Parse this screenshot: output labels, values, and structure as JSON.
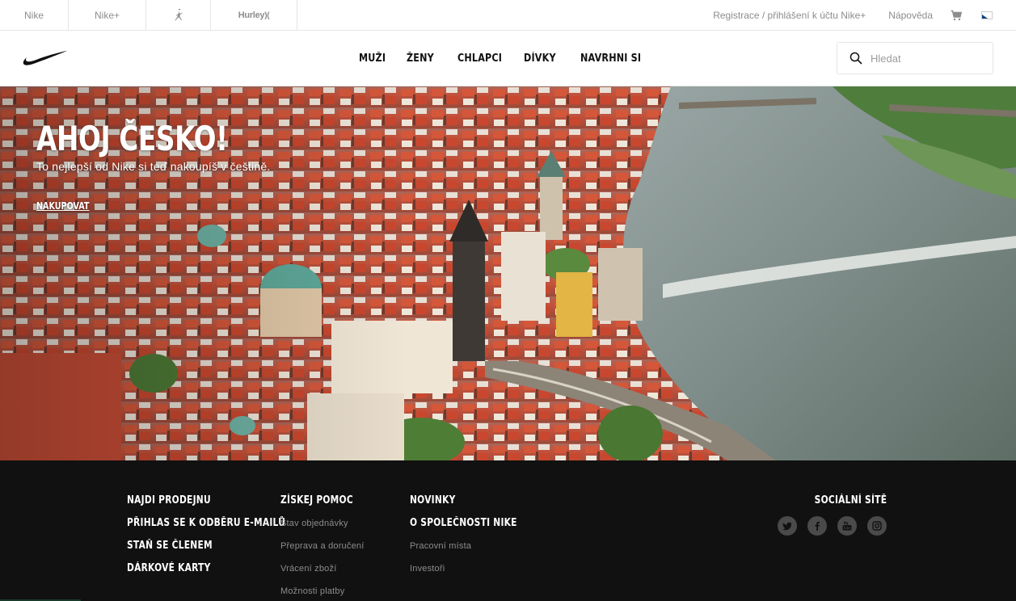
{
  "topbar": {
    "brand_tabs": [
      "Nike",
      "Nike+",
      "jordan-jumpman-logo",
      "Hurley"
    ],
    "nike_label": "Nike",
    "nikeplus_label": "Nike+",
    "hurley_label": "Hurley",
    "register_label": "Registrace / přihlášení k účtu Nike+",
    "help_label": "Nápověda",
    "cart_icon": "cart-icon",
    "flag_icon": "czech-flag-icon"
  },
  "nav": {
    "logo": "nike-swoosh-logo",
    "items": [
      {
        "label": "MUŽI"
      },
      {
        "label": "ŽENY"
      },
      {
        "label": "CHLAPCI"
      },
      {
        "label": "DÍVKY"
      },
      {
        "label": "NAVRHNI SI"
      }
    ],
    "search": {
      "placeholder": "Hledat",
      "value": "",
      "icon": "search-icon"
    }
  },
  "hero": {
    "title": "AHOJ ČESKO!",
    "subtitle": "To nejlepší od Nike si teď nakoupíš v češtině.",
    "cta": "NAKUPOVAT"
  },
  "footer": {
    "col1": [
      "NAJDI PRODEJNU",
      "PŘIHLAS SE K ODBĚRU E-MAILŮ",
      "STAŇ SE ČLENEM",
      "DÁRKOVÉ KARTY"
    ],
    "col2": {
      "heading": "ZÍSKEJ POMOC",
      "links": [
        "Stav objednávky",
        "Přeprava a doručení",
        "Vrácení zboží",
        "Možnosti platby"
      ]
    },
    "col3": {
      "heading1": "NOVINKY",
      "heading2": "O SPOLEČNOSTI NIKE",
      "links": [
        "Pracovní místa",
        "Investoři"
      ]
    },
    "social": {
      "title": "SOCIÁLNÍ SÍTĚ",
      "icons": [
        "twitter-icon",
        "facebook-icon",
        "youtube-icon",
        "instagram-icon"
      ]
    }
  },
  "colors": {
    "footer_bg": "#111111",
    "footer_link": "#8d8d8d",
    "muted_text": "#8d8d8d"
  }
}
